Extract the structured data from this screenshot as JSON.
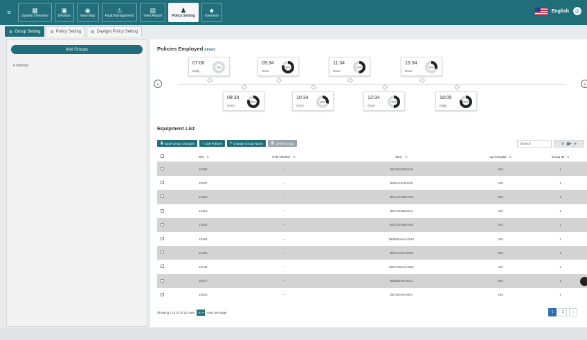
{
  "topbar": {
    "nav": [
      {
        "label": "System Overview",
        "icon": "grid-icon"
      },
      {
        "label": "Devices",
        "icon": "device-icon"
      },
      {
        "label": "View Map",
        "icon": "map-icon"
      },
      {
        "label": "Fault Management",
        "icon": "fault-icon"
      },
      {
        "label": "View Report",
        "icon": "report-icon"
      },
      {
        "label": "Policy Setting",
        "icon": "policy-icon",
        "active": true
      },
      {
        "label": "Inventory",
        "icon": "location-icon"
      }
    ],
    "language": "English"
  },
  "tabs": [
    {
      "label": "Group Setting",
      "active": true
    },
    {
      "label": "Policy Setting",
      "active": false
    },
    {
      "label": "Daylight Policy Setting",
      "active": false
    }
  ],
  "left": {
    "add_groups": "Add Groups",
    "tree_root": "▾ Vietnam"
  },
  "policies": {
    "title": "Policies Employed",
    "subtitle": "(timer)",
    "items": [
      {
        "time": "07:00",
        "freq": "Daily",
        "pct": 0,
        "label": "0%"
      },
      {
        "time": "08:34",
        "freq": "Once",
        "pct": 80,
        "label": "80%"
      },
      {
        "time": "09:34",
        "freq": "Once",
        "pct": 80,
        "label": "80%"
      },
      {
        "time": "10:34",
        "freq": "Once",
        "pct": 30,
        "label": "30%"
      },
      {
        "time": "11:34",
        "freq": "Once",
        "pct": 50,
        "label": "50%"
      },
      {
        "time": "12:34",
        "freq": "Once",
        "pct": 50,
        "label": "50%"
      },
      {
        "time": "15:34",
        "freq": "Once",
        "pct": 30,
        "label": "30%"
      },
      {
        "time": "18:05",
        "freq": "Daily",
        "pct": 80,
        "label": "80%"
      }
    ]
  },
  "equipment": {
    "title": "Equipment List",
    "buttons": {
      "save": "Save Group Changes",
      "link": "Link Policies",
      "rename": "Change Group Name",
      "delete": "Delete Group"
    },
    "search_placeholder": "Search",
    "columns": [
      "S/N",
      "Pole Number",
      "MAC",
      "Up GroupID",
      "Group ID"
    ],
    "rows": [
      {
        "sn": "18280",
        "pole": "---",
        "mac": "BEF86A8D4416",
        "up": "255",
        "gid": "1"
      },
      {
        "sn": "18297",
        "pole": "---",
        "mac": "BEBA64CE4455",
        "up": "255",
        "gid": "1"
      },
      {
        "sn": "18313",
        "pole": "---",
        "mac": "BECA6A6BA449",
        "up": "255",
        "gid": "1"
      },
      {
        "sn": "18315",
        "pole": "---",
        "mac": "BECD648E4451",
        "up": "255",
        "gid": "1"
      },
      {
        "sn": "19304",
        "pole": "---",
        "mac": "BECD6A8BA455",
        "up": "255",
        "gid": "1"
      },
      {
        "sn": "19384",
        "pole": "---",
        "mac": "BEBE8A6AC4520",
        "up": "255",
        "gid": "1"
      },
      {
        "sn": "19409",
        "pole": "---",
        "mac": "BEEA64CC4045",
        "up": "255",
        "gid": "1"
      },
      {
        "sn": "18446",
        "pole": "---",
        "mac": "BEEA864CF4582",
        "up": "255",
        "gid": "1"
      },
      {
        "sn": "18477",
        "pole": "---",
        "mac": "BBBB8A8A4611",
        "up": "255",
        "gid": "1"
      },
      {
        "sn": "18531",
        "pole": "---",
        "mac": "BEA88A8A4667",
        "up": "255",
        "gid": "1"
      }
    ],
    "footer": {
      "showing": "Showing 1 to 10 of 11 rows",
      "per_page_value": "10 ▾",
      "per_page_text": "rows per page"
    },
    "pager": [
      "1",
      "2",
      "›"
    ]
  },
  "colors": {
    "brand": "#1f6e7a",
    "shade_row": "#d3d3d3"
  }
}
